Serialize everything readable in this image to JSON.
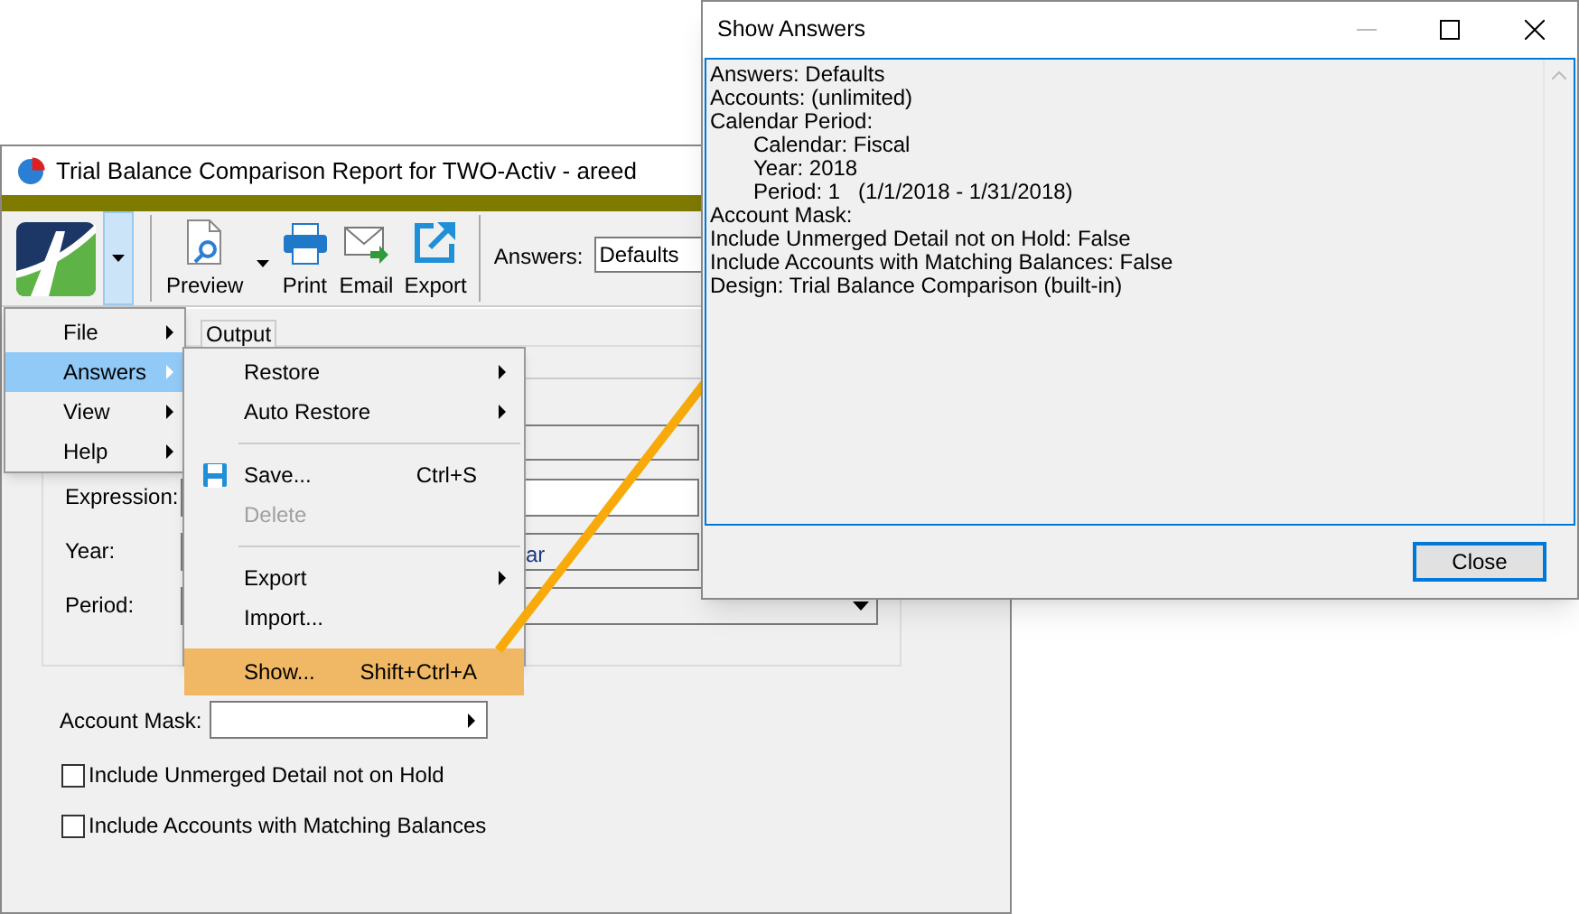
{
  "main_window": {
    "title": "Trial Balance Comparison Report for TWO-Activ - areed",
    "toolbar": {
      "buttons": [
        {
          "kind": "preview",
          "label": "Preview"
        },
        {
          "kind": "print",
          "label": "Print"
        },
        {
          "kind": "email",
          "label": "Email"
        },
        {
          "kind": "export",
          "label": "Export"
        }
      ],
      "answers_label": "Answers:",
      "answers_value": "Defaults"
    },
    "tabs": [
      {
        "label": "Output",
        "selected": true
      }
    ],
    "form": {
      "expression_label": "Expression:",
      "year_label": "Year:",
      "year_value_fragment": "ar",
      "period_label": "Period:",
      "account_mask_label": "Account Mask:",
      "checkboxes": [
        {
          "label": "Include Unmerged Detail not on Hold",
          "checked": false
        },
        {
          "label": "Include Accounts with Matching Balances",
          "checked": false
        }
      ]
    }
  },
  "menu": {
    "items": [
      {
        "label": "File",
        "selected": false
      },
      {
        "label": "Answers",
        "selected": true
      },
      {
        "label": "View",
        "selected": false
      },
      {
        "label": "Help",
        "selected": false
      }
    ]
  },
  "submenu": {
    "items": [
      {
        "kind": "item",
        "label": "Restore",
        "has_submenu": true,
        "disabled": false,
        "selected": false
      },
      {
        "kind": "item",
        "label": "Auto Restore",
        "has_submenu": true,
        "disabled": false,
        "selected": false
      },
      {
        "kind": "separator"
      },
      {
        "kind": "icon",
        "label": "Save...",
        "shortcut": "Ctrl+S",
        "has_submenu": false,
        "disabled": false,
        "selected": false
      },
      {
        "kind": "item",
        "label": "Delete",
        "has_submenu": false,
        "disabled": true,
        "selected": false
      },
      {
        "kind": "separator"
      },
      {
        "kind": "item",
        "label": "Export",
        "has_submenu": true,
        "disabled": false,
        "selected": false
      },
      {
        "kind": "item",
        "label": "Import...",
        "has_submenu": false,
        "disabled": false,
        "selected": false
      },
      {
        "kind": "item",
        "label": "Show...",
        "shortcut": "Shift+Ctrl+A",
        "has_submenu": false,
        "disabled": false,
        "selected": true
      }
    ]
  },
  "dialog": {
    "title": "Show Answers",
    "lines": [
      {
        "text": "Answers: Defaults"
      },
      {
        "text": "Accounts: (unlimited)"
      },
      {
        "text": "Calendar Period:",
        "children": [
          {
            "text": "Calendar: Fiscal"
          },
          {
            "text": "Year: 2018"
          },
          {
            "text": "Period: 1   (1/1/2018 - 1/31/2018)"
          }
        ]
      },
      {
        "text": "Account Mask:"
      },
      {
        "text": "Include Unmerged Detail not on Hold: False"
      },
      {
        "text": "Include Accounts with Matching Balances: False"
      },
      {
        "text": "Design: Trial Balance Comparison (built-in)"
      }
    ],
    "button": "Close"
  }
}
